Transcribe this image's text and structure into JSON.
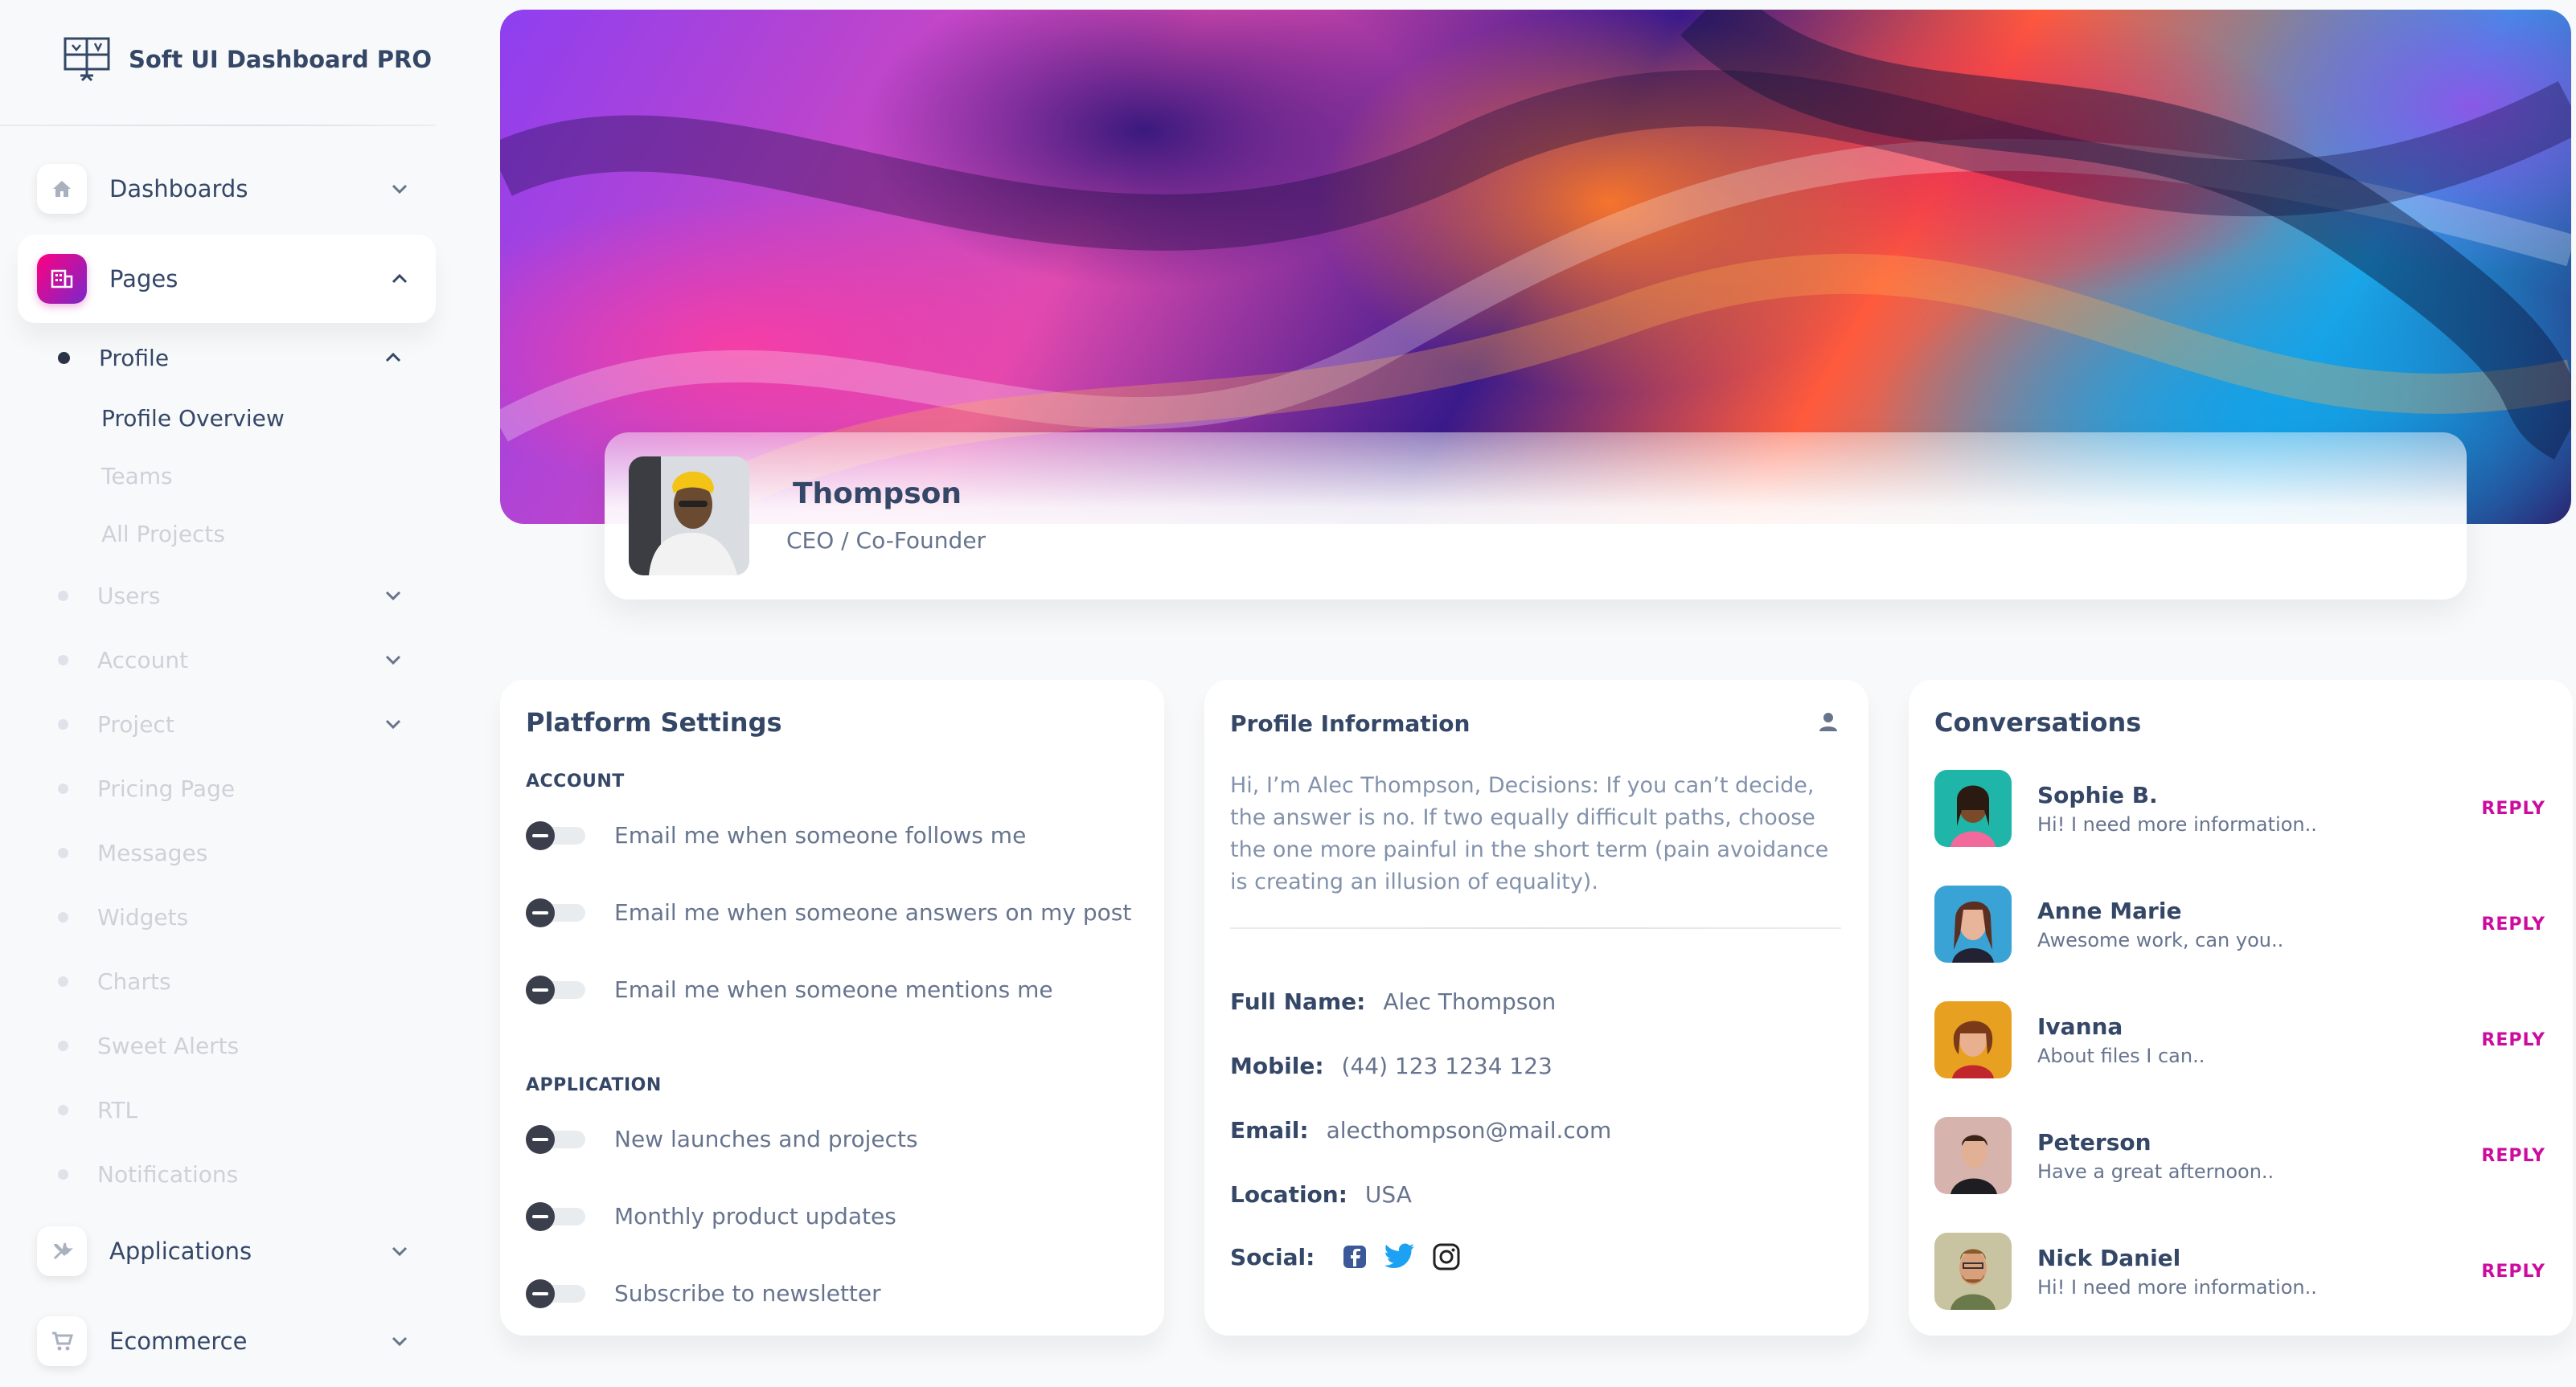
{
  "brand": {
    "name": "Soft UI Dashboard PRO",
    "logo_icon": "dashboard-logo-icon"
  },
  "sidebar": {
    "dashboards": "Dashboards",
    "pages": "Pages",
    "profile": "Profile",
    "profile_children": [
      "Profile Overview",
      "Teams",
      "All Projects"
    ],
    "users": "Users",
    "account": "Account",
    "project": "Project",
    "pricing": "Pricing Page",
    "messages": "Messages",
    "widgets": "Widgets",
    "charts": "Charts",
    "sweet_alerts": "Sweet Alerts",
    "rtl": "RTL",
    "notifications": "Notifications",
    "applications": "Applications",
    "ecommerce": "Ecommerce"
  },
  "profile": {
    "name": "Thompson",
    "role": "CEO / Co-Founder"
  },
  "platform_settings": {
    "title": "Platform Settings",
    "account_label": "ACCOUNT",
    "account_items": [
      "Email me when someone follows me",
      "Email me when someone answers on my post",
      "Email me when someone mentions me"
    ],
    "application_label": "APPLICATION",
    "application_items": [
      "New launches and projects",
      "Monthly product updates",
      "Subscribe to newsletter"
    ]
  },
  "profile_info": {
    "title": "Profile Information",
    "bio": "Hi, I’m Alec Thompson, Decisions: If you can’t decide, the answer is no. If two equally difficult paths, choose the one more painful in the short term (pain avoidance is creating an illusion of equality).",
    "full_name_label": "Full Name:",
    "full_name": "Alec Thompson",
    "mobile_label": "Mobile:",
    "mobile": "(44) 123 1234 123",
    "email_label": "Email:",
    "email": "alecthompson@mail.com",
    "location_label": "Location:",
    "location": "USA",
    "social_label": "Social:"
  },
  "conversations": {
    "title": "Conversations",
    "reply_label": "REPLY",
    "items": [
      {
        "name": "Sophie B.",
        "msg": "Hi! I need more information.."
      },
      {
        "name": "Anne Marie",
        "msg": "Awesome work, can you.."
      },
      {
        "name": "Ivanna",
        "msg": "About files I can.."
      },
      {
        "name": "Peterson",
        "msg": "Have a great afternoon.."
      },
      {
        "name": "Nick Daniel",
        "msg": "Hi! I need more information.."
      }
    ]
  },
  "colors": {
    "accent": "#cb0c9f",
    "text": "#344767",
    "muted": "#67748e"
  }
}
